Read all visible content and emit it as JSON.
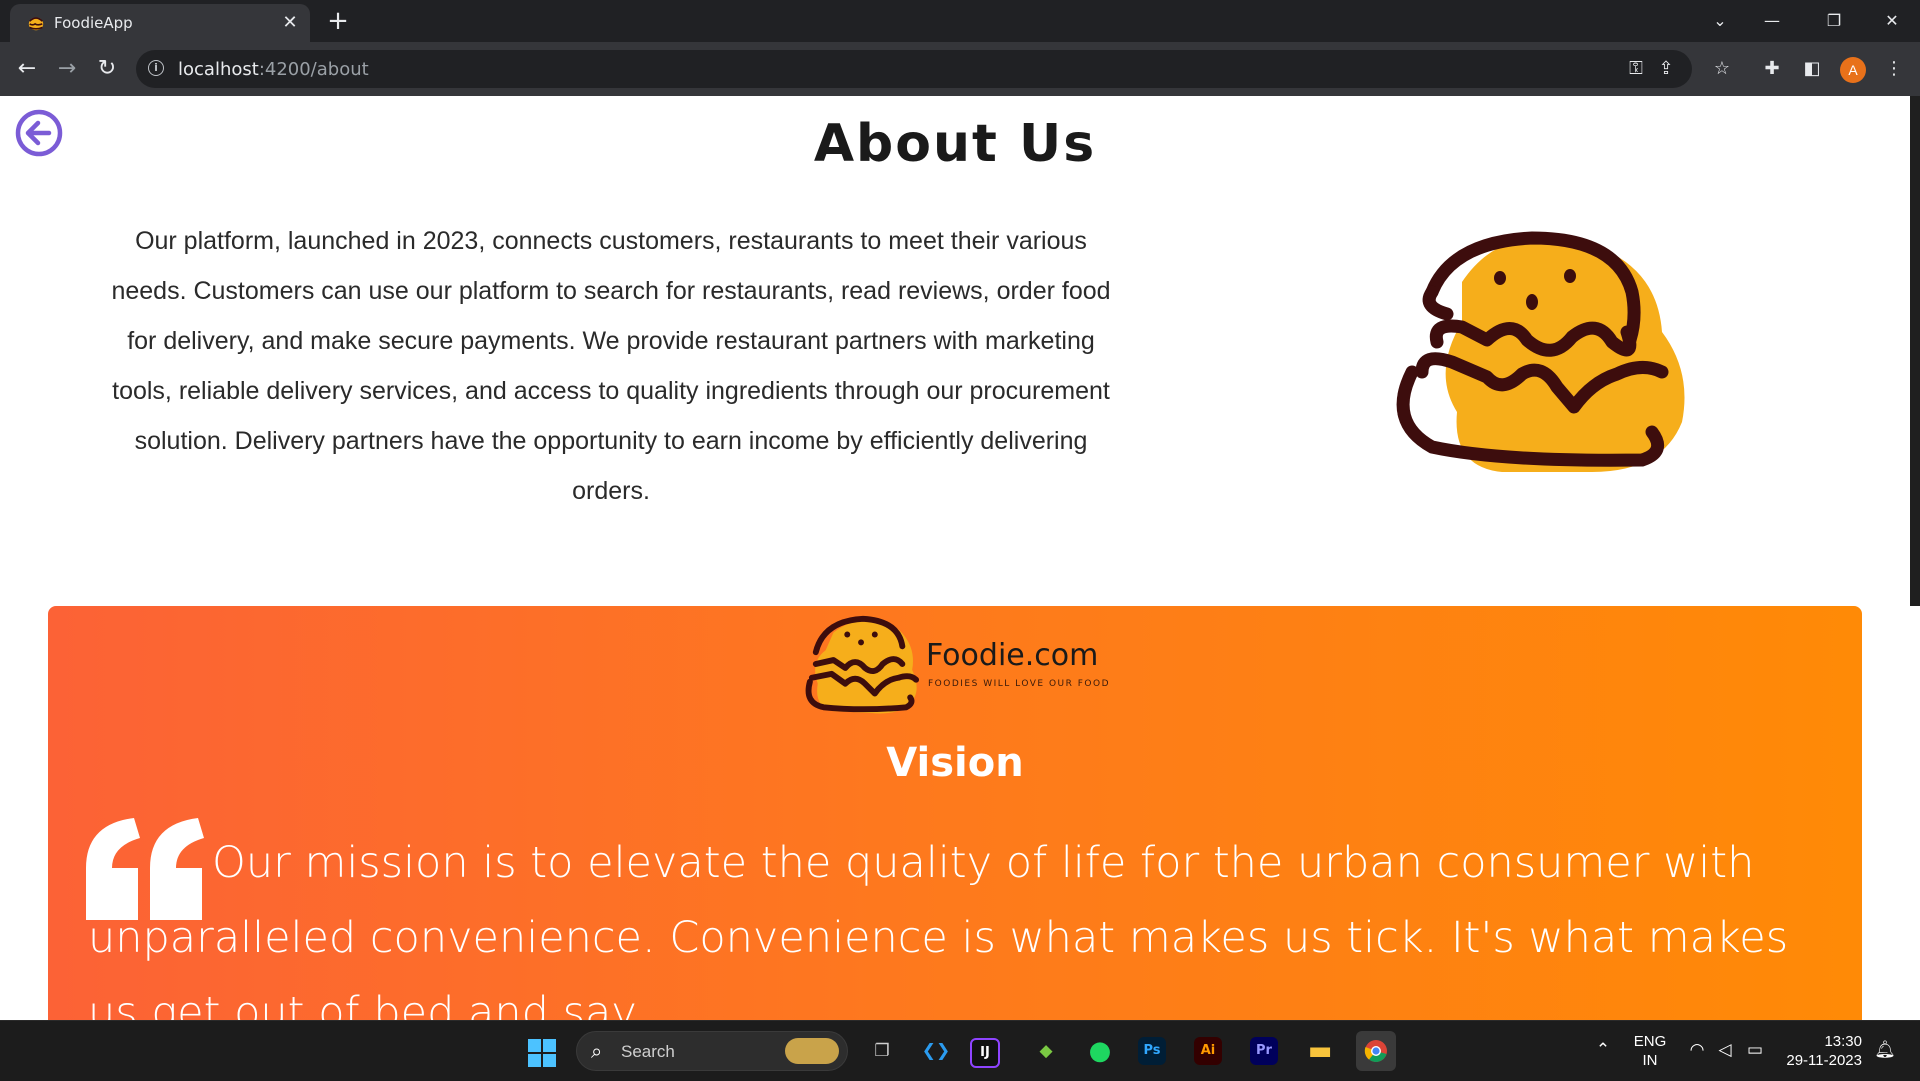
{
  "browser": {
    "tab_title": "FoodieApp",
    "tab_close": "✕",
    "new_tab": "+",
    "url_host": "localhost",
    "url_path": ":4200/about",
    "profile_initial": "A"
  },
  "page": {
    "title": "About Us",
    "about_text": "Our platform, launched in 2023, connects customers, restaurants to meet their various needs. Customers can use our platform to search for restaurants, read reviews, order food for delivery, and make secure payments. We provide restaurant partners with marketing tools, reliable delivery services, and access to quality ingredients through our procurement solution. Delivery partners have the opportunity to earn income by efficiently delivering orders.",
    "logo_name": "Foodie.com",
    "logo_tagline": "FOODIES WILL LOVE OUR FOOD",
    "vision_title": "Vision",
    "mission_text": "Our mission is to elevate the quality of life for the urban consumer with unparalleled convenience. Convenience is what makes us tick. It's what makes us get out of bed and say,"
  },
  "taskbar": {
    "search_label": "Search",
    "apps": [
      "windows-start",
      "file-explorer-tasks",
      "vs-code",
      "intellij",
      "bluestacks",
      "spotify",
      "photoshop",
      "illustrator",
      "premiere-pro",
      "file-explorer",
      "chrome"
    ],
    "language": "ENG",
    "region": "IN",
    "time": "13:30",
    "date": "29-11-2023"
  },
  "colors": {
    "vision_gradient_start": "#fc6236",
    "vision_gradient_end": "#ff8a06",
    "burger_yellow": "#f6ae1b",
    "burger_dark": "#3d0d0d",
    "back_arrow": "#7b5cd6"
  }
}
